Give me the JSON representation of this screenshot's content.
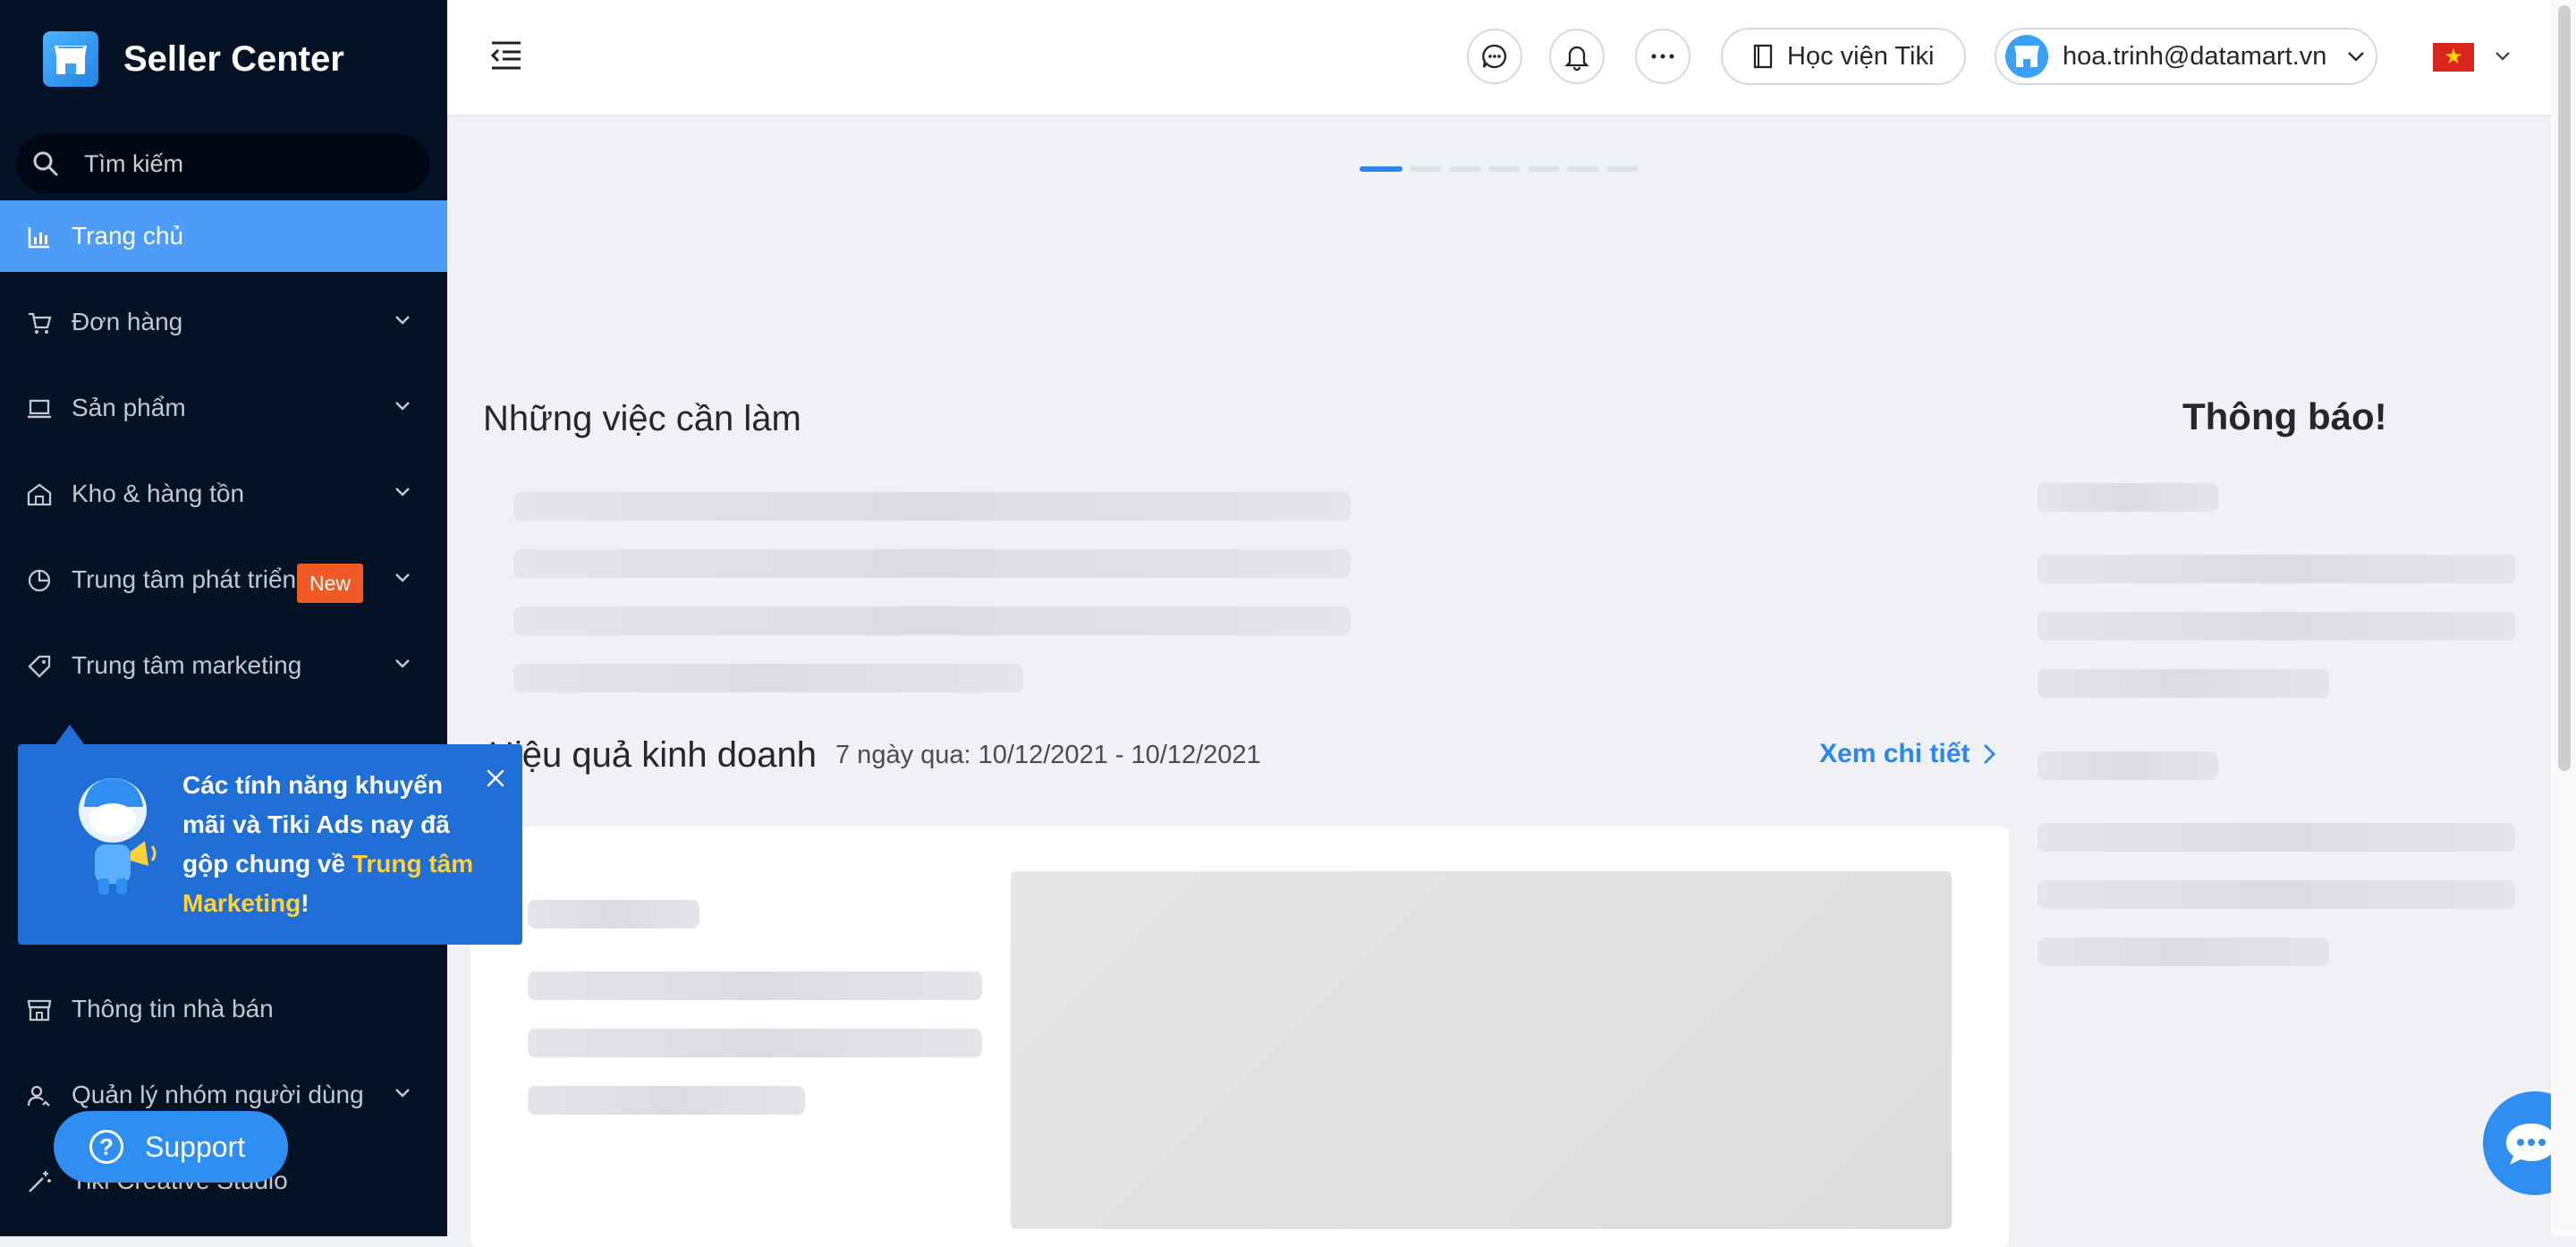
{
  "brand": {
    "title": "Seller Center"
  },
  "search": {
    "placeholder": "Tìm kiếm"
  },
  "sidebar": {
    "items": [
      {
        "label": "Trang chủ",
        "icon": "bar-chart-icon",
        "active": true
      },
      {
        "label": "Đơn hàng",
        "icon": "cart-icon",
        "expandable": true
      },
      {
        "label": "Sản phẩm",
        "icon": "laptop-icon",
        "expandable": true
      },
      {
        "label": "Kho & hàng tồn",
        "icon": "warehouse-icon",
        "expandable": true
      },
      {
        "label": "Trung tâm phát triển",
        "icon": "pie-chart-icon",
        "expandable": true,
        "badge": "New"
      },
      {
        "label": "Trung tâm marketing",
        "icon": "tag-icon",
        "expandable": true
      },
      {
        "label": "Thông tin nhà bán",
        "icon": "shop-icon",
        "expandable": false
      },
      {
        "label": "Quản lý nhóm người dùng",
        "icon": "users-icon",
        "expandable": true
      },
      {
        "label": "Tiki Creative Studio",
        "icon": "magic-wand-icon",
        "expandable": false
      }
    ]
  },
  "popup": {
    "text_before": "Các tính năng khuyến mãi và Tiki Ads nay đã gộp chung về ",
    "highlight": "Trung tâm Marketing",
    "text_after": "!"
  },
  "support": {
    "label": "Support"
  },
  "header": {
    "academy_label": "Học viện Tiki",
    "account_email": "hoa.trinh@datamart.vn",
    "language_flag": "vn-flag-icon"
  },
  "main": {
    "todo_title": "Những việc cần làm",
    "performance_title": "Hiệu quả kinh doanh",
    "date_range": "7 ngày qua: 10/12/2021 - 10/12/2021",
    "detail_link": "Xem chi tiết",
    "notice_title": "Thông báo!"
  },
  "colors": {
    "sidebar_bg": "#031225",
    "active_item": "#4d9cf7",
    "accent": "#2d86ee",
    "popup_bg": "#1f6fd6",
    "highlight": "#ffd23c",
    "badge_new": "#f05a24"
  }
}
